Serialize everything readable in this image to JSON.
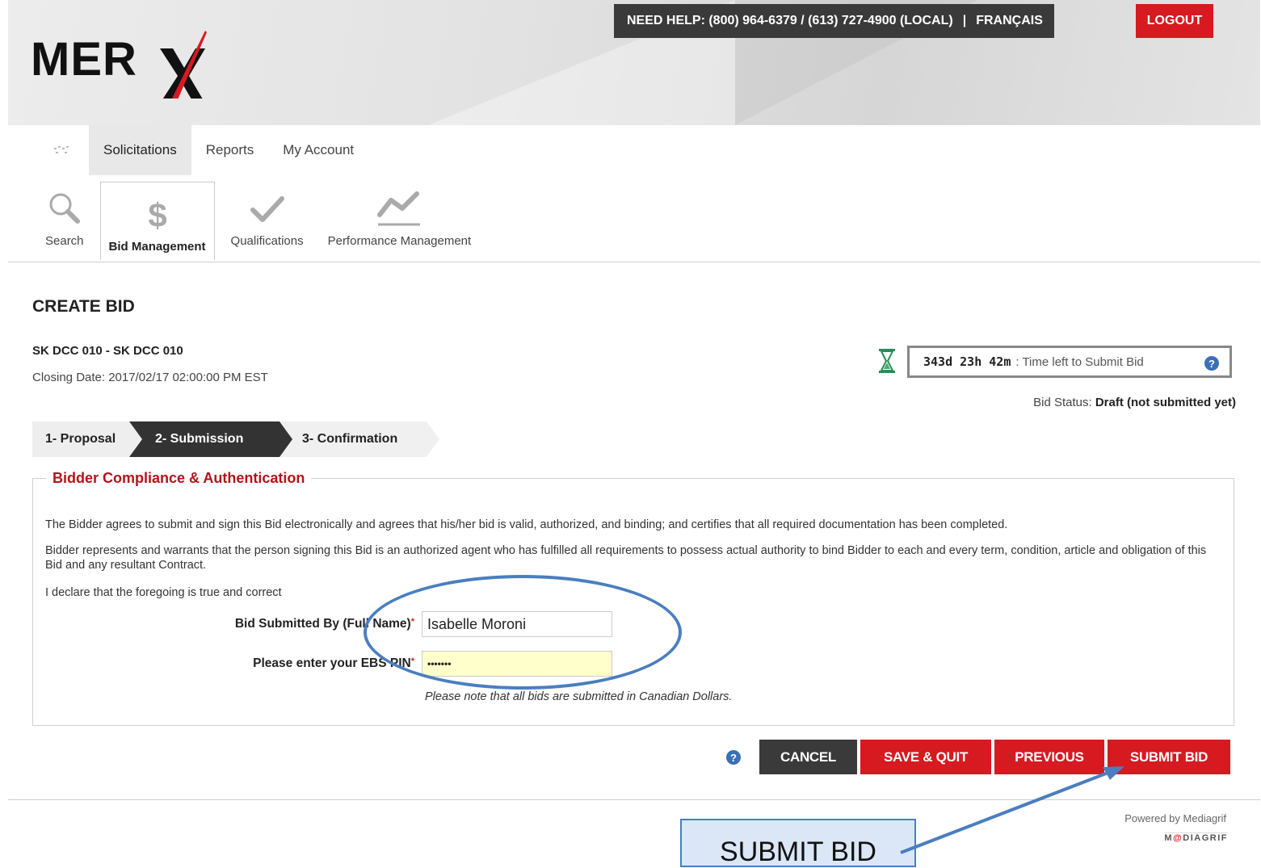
{
  "header": {
    "logo_text": "MER",
    "help_text": "NEED HELP: (800) 964-6379 / (613) 727-4900 (LOCAL)",
    "separator": "|",
    "language_link": "FRANÇAIS",
    "logout_label": "LOGOUT"
  },
  "nav": {
    "tabs": [
      {
        "label": "Solicitations"
      },
      {
        "label": "Reports"
      },
      {
        "label": "My Account"
      }
    ],
    "subnav": [
      {
        "label": "Search",
        "icon": "magnifier-icon"
      },
      {
        "label": "Bid Management",
        "icon": "dollar-icon"
      },
      {
        "label": "Qualifications",
        "icon": "checkmark-icon"
      },
      {
        "label": "Performance Management",
        "icon": "trend-line-icon"
      }
    ]
  },
  "page": {
    "title": "CREATE BID",
    "reference": "SK DCC 010 - SK DCC 010",
    "closing_date": "Closing Date: 2017/02/17 02:00:00 PM EST",
    "timer_value": "343d 23h 42m",
    "timer_label": ": Time left to Submit Bid",
    "bid_status_label": "Bid Status:",
    "bid_status_value": "Draft (not submitted yet)"
  },
  "steps": [
    {
      "label": "1- Proposal"
    },
    {
      "label": "2- Submission"
    },
    {
      "label": "3- Confirmation"
    }
  ],
  "compliance": {
    "legend": "Bidder Compliance & Authentication",
    "para1": "The Bidder agrees to submit and sign this Bid electronically and agrees that his/her bid is valid, authorized, and binding; and certifies that all required documentation has been completed.",
    "para2": "Bidder represents and warrants that the person signing this Bid is an authorized agent who has fulfilled all requirements to possess actual authority to bind Bidder to each and every term, condition, article and obligation of this Bid and any resultant Contract.",
    "para3": "I declare that the foregoing is true and correct",
    "name_label": "Bid Submitted By (Full Name)",
    "name_value": "Isabelle Moroni",
    "pin_label": "Please enter your EBS PIN",
    "pin_value": "•••••••",
    "required_mark": "*",
    "note": "Please note that all bids are submitted in Canadian Dollars."
  },
  "actions": {
    "cancel": "CANCEL",
    "save_quit": "SAVE & QUIT",
    "previous": "PREVIOUS",
    "submit": "SUBMIT BID"
  },
  "footer": {
    "powered_by": "Powered by Mediagrif",
    "brand_left": "M",
    "brand_right": "DIAGRIF"
  },
  "annotation": {
    "callout_text": "SUBMIT BID"
  },
  "colors": {
    "brand_red": "#d71920",
    "dark": "#3a3a3a",
    "annotation_blue": "#4a7ec0"
  }
}
